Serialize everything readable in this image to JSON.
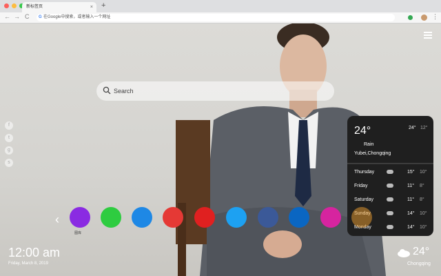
{
  "browser": {
    "tab_title": "新标签页",
    "tab_close": "×",
    "new_tab": "+",
    "nav_back": "←",
    "nav_forward": "→",
    "nav_reload": "C",
    "g_logo": "G",
    "omnibox_text": "在Google中搜索，或者输入一个网址",
    "menu_glyph": "⋮"
  },
  "search": {
    "placeholder": "Search"
  },
  "social": [
    {
      "glyph": "f",
      "icon": "facebook-icon"
    },
    {
      "glyph": "t",
      "icon": "twitter-icon"
    },
    {
      "glyph": "g",
      "icon": "google-plus-icon"
    },
    {
      "glyph": "s",
      "icon": "share-icon"
    }
  ],
  "weather": {
    "temp": "24°",
    "high": "24°",
    "low": "12°",
    "condition": "Rain",
    "location": "Yubei,Chongqing",
    "forecast": [
      {
        "day": "Thursday",
        "hi": "15°",
        "lo": "10°"
      },
      {
        "day": "Friday",
        "hi": "11°",
        "lo": "8°"
      },
      {
        "day": "Saturday",
        "hi": "11°",
        "lo": "8°"
      },
      {
        "day": "Sunday",
        "hi": "14°",
        "lo": "10°"
      },
      {
        "day": "Monday",
        "hi": "14°",
        "lo": "10°"
      }
    ]
  },
  "dock": {
    "prev": "‹",
    "first_label": "图库",
    "apps": [
      {
        "icon": "gallery-icon",
        "color": "#8a2be2"
      },
      {
        "icon": "checklist-icon",
        "color": "#2ecc40"
      },
      {
        "icon": "notes-icon",
        "color": "#1e88e5"
      },
      {
        "icon": "paint-icon",
        "color": "#e53935"
      },
      {
        "icon": "youtube-icon",
        "color": "#e02020"
      },
      {
        "icon": "twitter-icon",
        "color": "#1da1f2"
      },
      {
        "icon": "facebook-icon",
        "color": "#3b5998"
      },
      {
        "icon": "linkedin-icon",
        "color": "#0a66c2"
      },
      {
        "icon": "instagram-icon",
        "color": "#d6249f"
      },
      {
        "icon": "amazon-icon",
        "color": "#f0a030"
      }
    ]
  },
  "clock": {
    "time": "12:00 am",
    "date": "Friday, March 8, 2019"
  },
  "bottom_weather": {
    "temp": "24°",
    "city": "Chongqing"
  }
}
